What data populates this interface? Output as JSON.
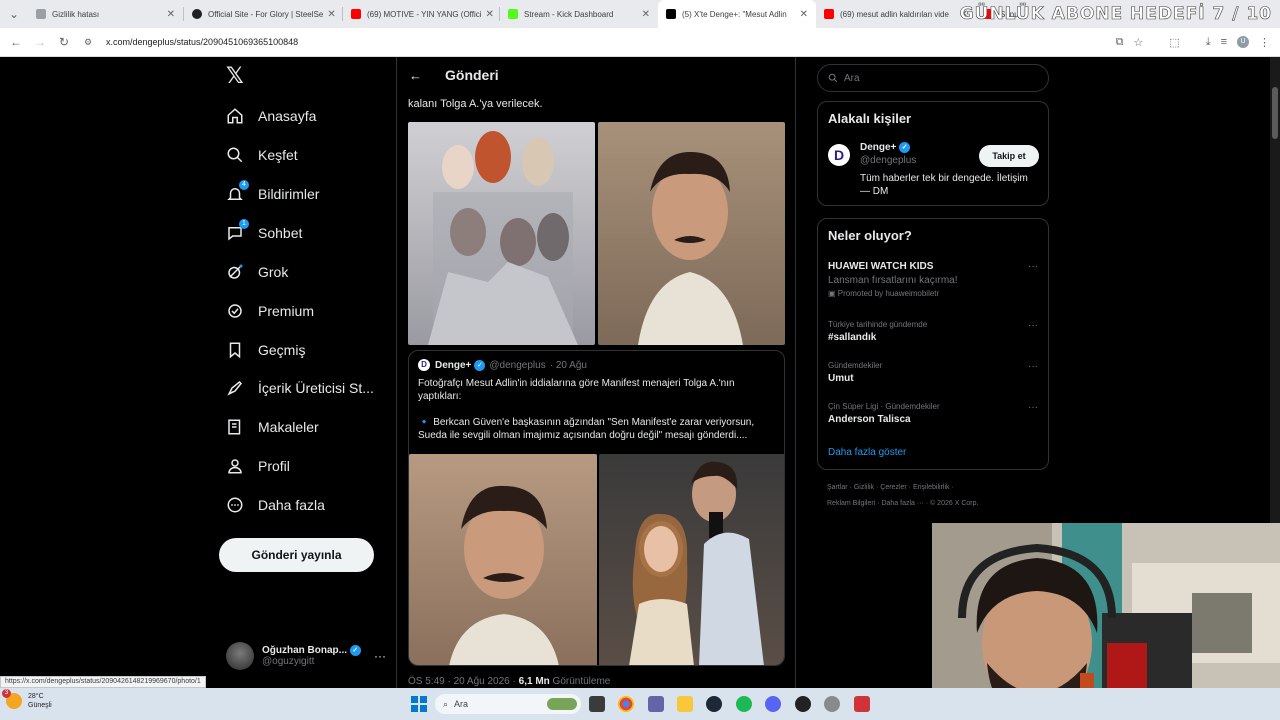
{
  "browser": {
    "tabs": [
      {
        "title": "Gizlilik hatası",
        "color": "#9aa0a6"
      },
      {
        "title": "Official Site - For Glory | SteelSe",
        "color": "#202124"
      },
      {
        "title": "(69) MOTIVE - YIN YANG (Offici",
        "color": "#ff0000"
      },
      {
        "title": "Stream - Kick Dashboard",
        "color": "#53fc18"
      },
      {
        "title": "(5) X'te Denge+: \"Mesut Adlin",
        "color": "#000000"
      },
      {
        "title": "(69) mesut adlin kaldırılan vide",
        "color": "#ff0000"
      },
      {
        "title": "Sunu",
        "color": "#ff0000"
      }
    ],
    "overlay_text": "GÜNLÜK ABONE HEDEFİ 7 / 10",
    "url": "x.com/dengeplus/status/2090451069365100848",
    "profile_initial": "U",
    "status_url": "https://x.com/dengeplus/status/2090426148219969670/photo/1"
  },
  "nav": {
    "items": [
      {
        "label": "Anasayfa",
        "icon": "home-icon"
      },
      {
        "label": "Keşfet",
        "icon": "search-icon"
      },
      {
        "label": "Bildirimler",
        "icon": "bell-icon",
        "badge": "4"
      },
      {
        "label": "Sohbet",
        "icon": "chat-icon",
        "badge": "1"
      },
      {
        "label": "Grok",
        "icon": "grok-icon"
      },
      {
        "label": "Premium",
        "icon": "premium-icon"
      },
      {
        "label": "Geçmiş",
        "icon": "bookmark-icon"
      },
      {
        "label": "İçerik Üreticisi St...",
        "icon": "rocket-icon"
      },
      {
        "label": "Makaleler",
        "icon": "article-icon"
      },
      {
        "label": "Profil",
        "icon": "profile-icon"
      },
      {
        "label": "Daha fazla",
        "icon": "more-circle-icon"
      }
    ],
    "post_button": "Gönderi yayınla",
    "user": {
      "name": "Oğuzhan Bonap...",
      "handle": "@oguzyigitt"
    }
  },
  "post": {
    "header_title": "Gönderi",
    "text_tail": "kalanı Tolga A.'ya verilecek.",
    "quote": {
      "name": "Denge+",
      "handle": "@dengeplus",
      "date": "· 20 Ağu",
      "avatar_letter": "D",
      "text1": "Fotoğrafçı Mesut Adlin'in iddialarına göre Manifest menajeri Tolga A.'nın yaptıkları:",
      "text2": "🔹 Berkcan Güven'e başkasının ağzından \"Sen Manifest'e zarar veriyorsun, Sueda ile sevgili olman imajımız açısından doğru değil\" mesajı gönderdi...."
    },
    "time": "ÖS 5:49 · 20 Ağu 2026 · ",
    "views": "6,1 Mn",
    "views_label": " Görüntüleme"
  },
  "sidebar": {
    "search_placeholder": "Ara",
    "related_title": "Alakalı kişiler",
    "related": {
      "name": "Denge+",
      "handle": "@dengeplus",
      "bio": "Tüm haberler tek bir dengede. İletişim — DM",
      "follow_label": "Takip et"
    },
    "trends_title": "Neler oluyor?",
    "trends": [
      {
        "context": "",
        "title": "HUAWEI WATCH KIDS",
        "sub": "Lansman fırsatlarını kaçırma!",
        "promo": "Promoted by huaweimobiletr"
      },
      {
        "context": "Türkiye tarihinde gündemde",
        "title": "#sallandık",
        "sub": "",
        "promo": ""
      },
      {
        "context": "Gündemdekiler",
        "title": "Umut",
        "sub": "",
        "promo": ""
      },
      {
        "context": "Çin Süper Ligi · Gündemdekiler",
        "title": "Anderson Talisca",
        "sub": "",
        "promo": ""
      }
    ],
    "show_more": "Daha fazla göster",
    "footer1": "Şartlar  ·  Gizlilik  ·  Çerezler  ·  Erişilebilirlik  ·",
    "footer2": "Reklam Bilgileri  ·  Daha fazla ···  ·  © 2026 X Corp."
  },
  "taskbar": {
    "temp": "28°C",
    "weather": "Güneşli",
    "weather_badge": "3",
    "search": "Ara"
  }
}
